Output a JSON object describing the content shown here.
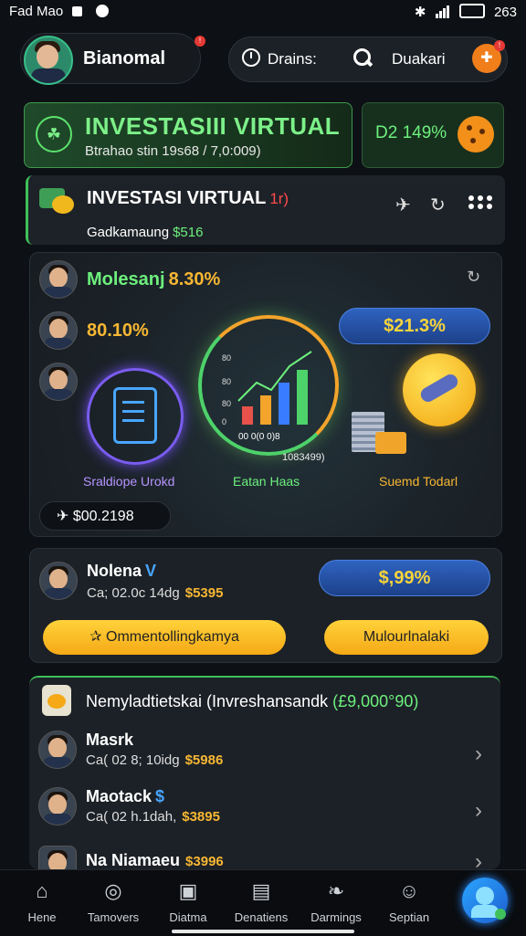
{
  "status": {
    "left": "Fad Mao",
    "right": "263"
  },
  "header": {
    "username": "Bianomal",
    "notif_badge": "!",
    "brains_label": "Drains:",
    "duakari_label": "Duakari",
    "cta_badge": "!"
  },
  "banner": {
    "title": "INVESTASIII VIRTUAL",
    "subtitle": "Btrahao stin 19s68 / 7,0:009)",
    "pct": "D2 149%"
  },
  "investasi": {
    "title": "INVESTASI VIRTUAL",
    "title_tag": "1r)",
    "subtitle": "Gadkamaung",
    "amount": "$516"
  },
  "panel": {
    "name": "Molesanj",
    "name_pct": "8.30%",
    "pct2": "80.10%",
    "pill_value": "$21.3%",
    "items": [
      {
        "label": "Sraldiope Urokd"
      },
      {
        "label": "Eatan Haas"
      },
      {
        "label": "Suemd Todarl"
      }
    ],
    "chart_axis": [
      "80",
      "80",
      "80",
      "0"
    ],
    "chart_caption": "00 0(0 0)8",
    "chart_subcaption": "1083499)",
    "total": "✈ $00.2198"
  },
  "neleana": {
    "name": "Nolena",
    "verified": "V",
    "subtitle": "Ca; 02.0c 14dg",
    "amount": "$5395",
    "pill_value": "$,99%",
    "btn_primary": "✰ Ommentollingkamya",
    "btn_secondary": "Mulourlnalaki"
  },
  "list": {
    "header_prefix": "Nemyladtietskai (Invreshansandk ",
    "header_amount": "(£9,000°90)",
    "items": [
      {
        "name": "Masrk",
        "extra": "",
        "sub": "Ca( 02 8; 10idg",
        "amount": "$5986"
      },
      {
        "name": "Maotack",
        "extra": "$",
        "sub": "Ca( 02 h.1dah,",
        "amount": "$3895"
      },
      {
        "name": "Na Niamaeu",
        "extra": "",
        "sub": "",
        "amount": "$3996"
      }
    ]
  },
  "bottom_nav": [
    {
      "label": "Hene",
      "icon": "home-icon"
    },
    {
      "label": "Tamovers",
      "icon": "target-icon"
    },
    {
      "label": "Diatma",
      "icon": "cards-icon"
    },
    {
      "label": "Denatiens",
      "icon": "briefcase-icon"
    },
    {
      "label": "Darmings",
      "icon": "leaf-icon"
    },
    {
      "label": "Septian",
      "icon": "person-icon"
    }
  ],
  "colors": {
    "accent_green": "#6df07d",
    "accent_orange": "#f7b733",
    "accent_blue": "#2f63c0",
    "bg": "#0d1014"
  }
}
